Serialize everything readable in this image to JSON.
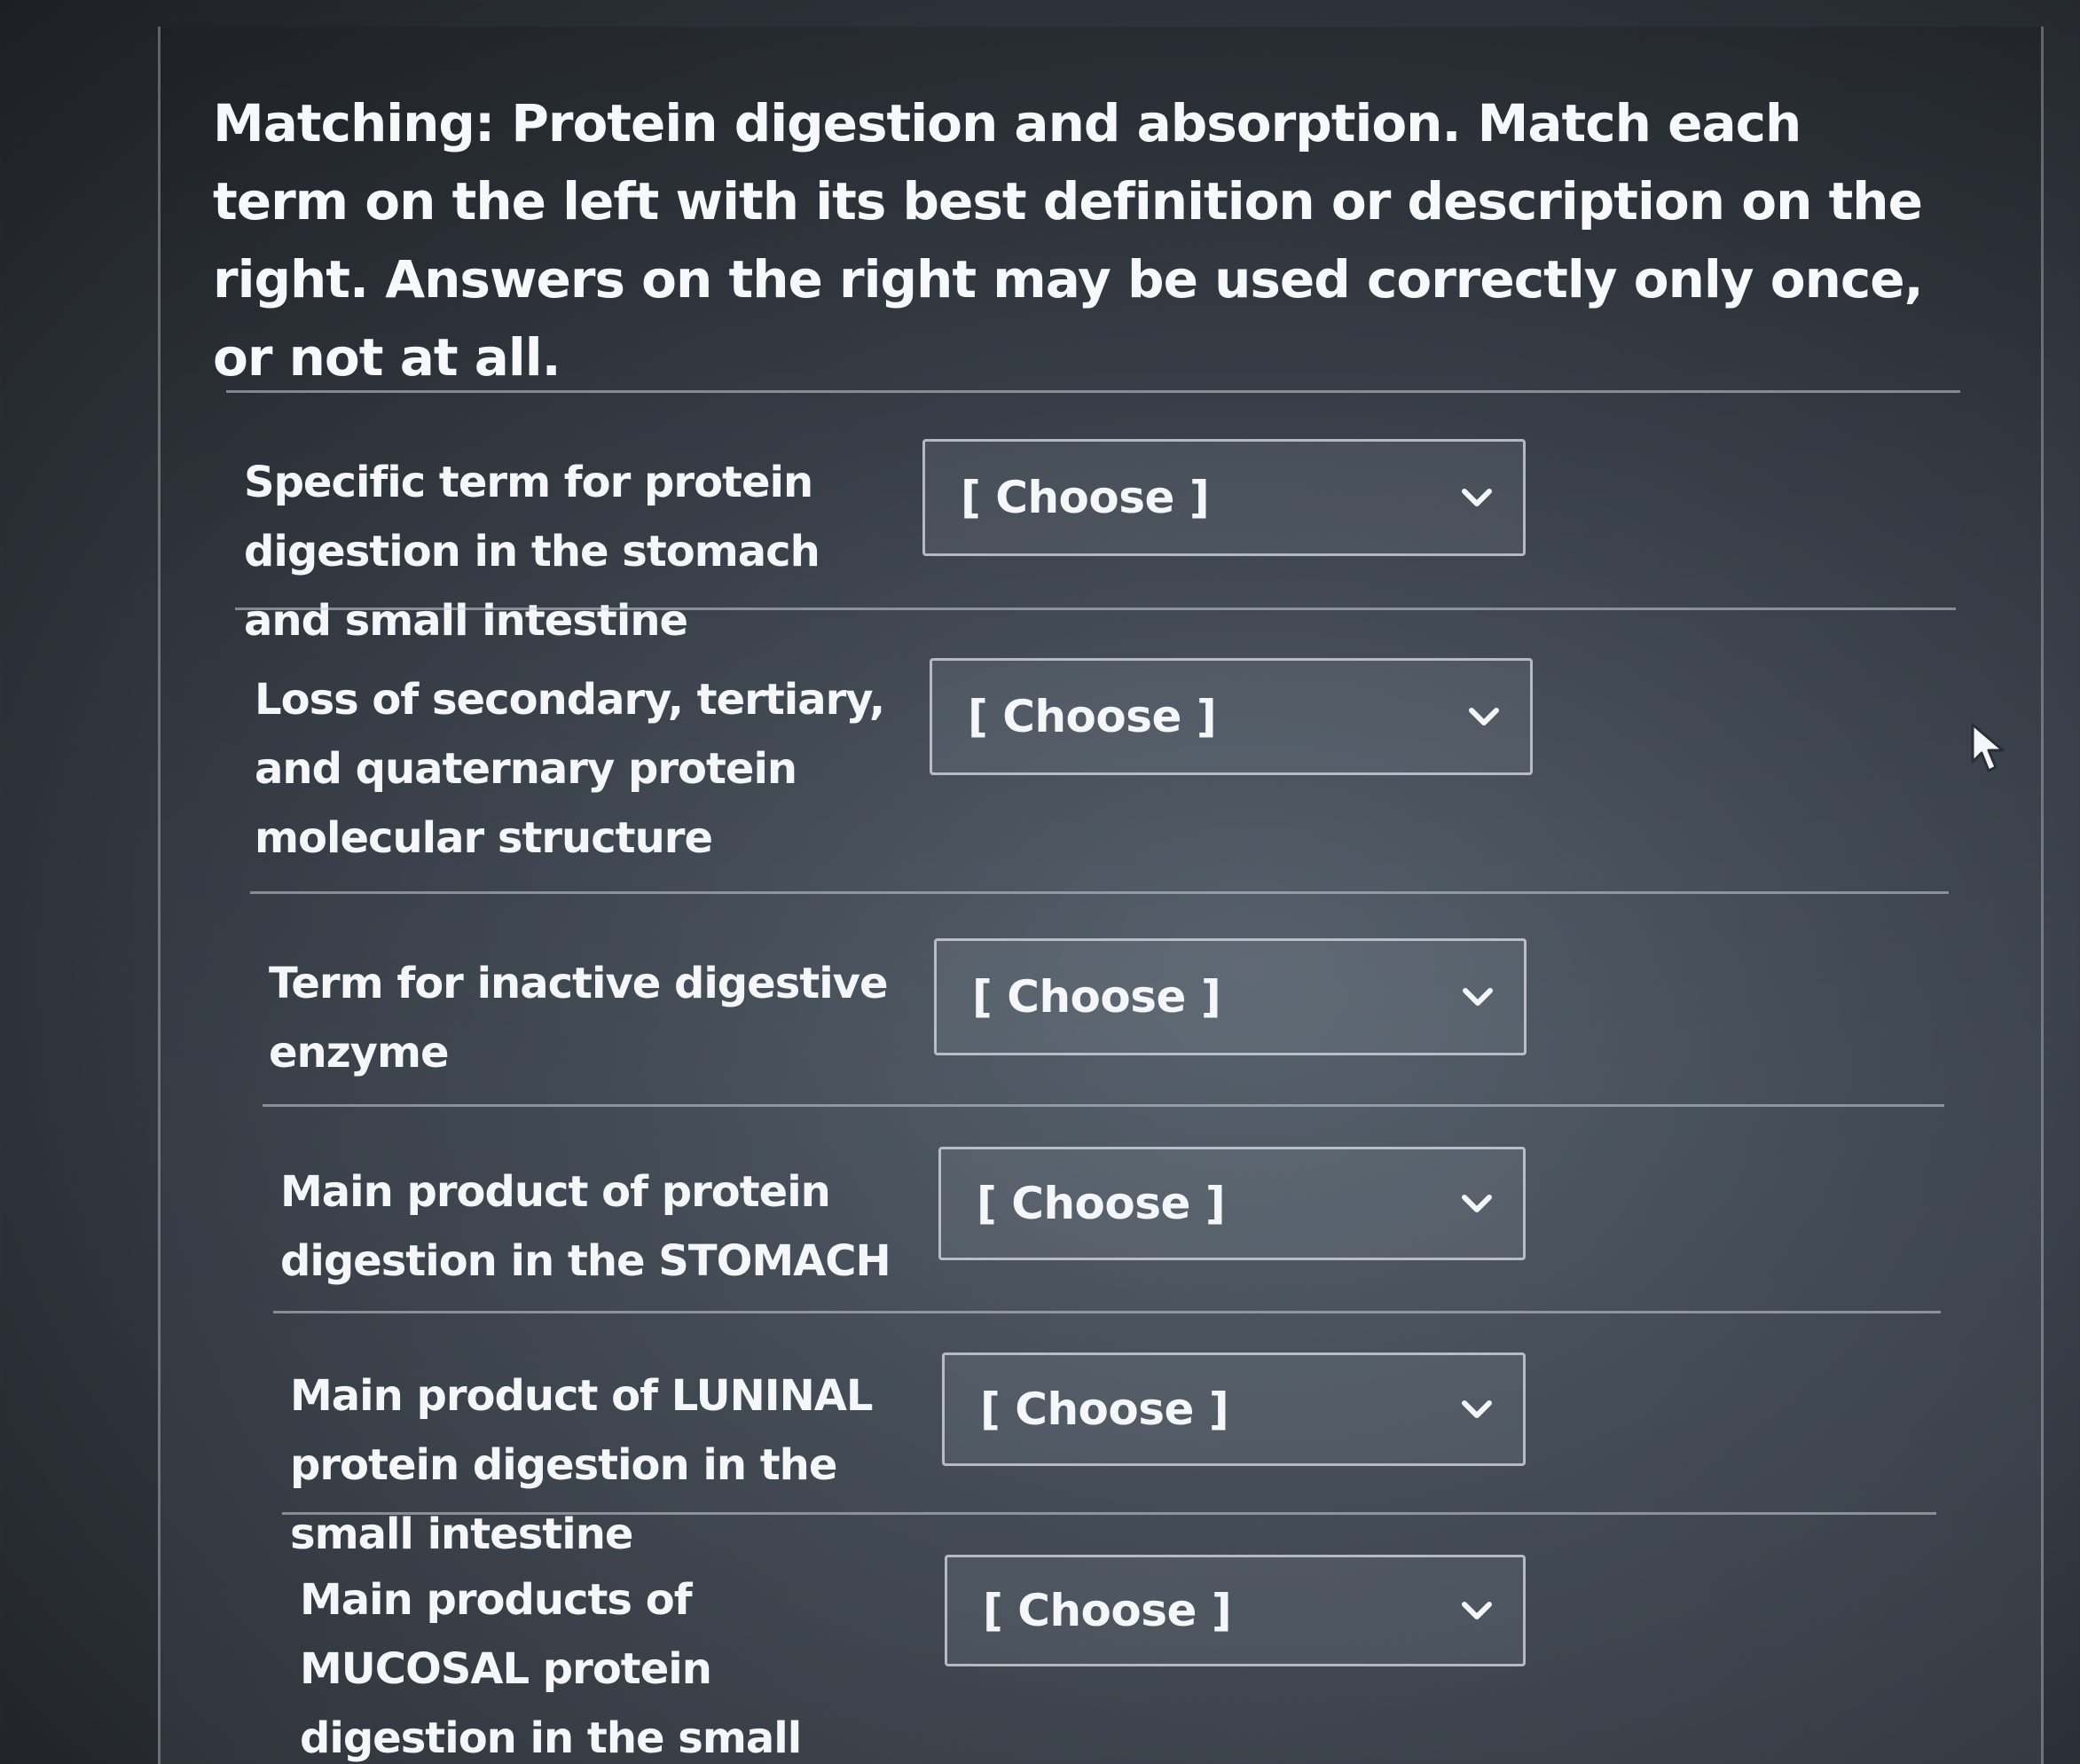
{
  "question": {
    "prompt": "Matching: Protein digestion and absorption. Match each term on the left with its best definition or description on the right. Answers on the  right may be used correctly only once, or not at all."
  },
  "rows": [
    {
      "term": "Specific term for protein digestion in the stomach and small intestine",
      "selected": "[ Choose ]"
    },
    {
      "term": "Loss of secondary, tertiary, and quaternary protein molecular structure",
      "selected": "[ Choose ]"
    },
    {
      "term": "Term for inactive digestive enzyme",
      "selected": "[ Choose ]"
    },
    {
      "term": "Main product of protein digestion in the STOMACH",
      "selected": "[ Choose ]"
    },
    {
      "term": "Main product of LUNINAL protein digestion in the small intestine",
      "selected": "[ Choose ]"
    },
    {
      "term": "Main products of MUCOSAL protein digestion in the small intestine",
      "selected": "[ Choose ]"
    }
  ],
  "icons": {
    "dropdown": "chevron-down-icon",
    "pointer": "mouse-pointer-icon"
  }
}
